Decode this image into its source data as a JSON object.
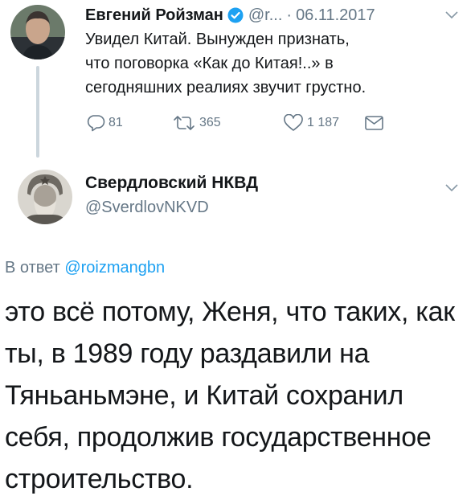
{
  "tweet1": {
    "author_name": "Евгений Ройзман",
    "verified_icon": "verified-badge-icon",
    "handle": "@r...",
    "separator": "·",
    "date": "06.11.2017",
    "text_lines": [
      "Увидел Китай. Вынужден признать,",
      "что поговорка «Как до Китая!..» в",
      "сегодняшних реалиях звучит грустно."
    ],
    "actions": {
      "replies": "81",
      "retweets": "365",
      "likes": "1 187"
    }
  },
  "tweet2": {
    "author_name": "Свердловский НКВД",
    "handle": "@SverdlovNKVD",
    "reply_prefix": "В ответ",
    "reply_mention": "@roizmangbn",
    "text_lines": [
      "это всё потому, Женя, что таких, как",
      "ты, в 1989 году раздавили на",
      "Тяньаньмэне, и Китай сохранил",
      "себя, продолжив государственное",
      "строительство."
    ]
  },
  "colors": {
    "text": "#14171a",
    "secondary": "#657786",
    "link": "#1da1f2",
    "verified": "#1da1f2",
    "thread_line": "#ccd6dd"
  }
}
